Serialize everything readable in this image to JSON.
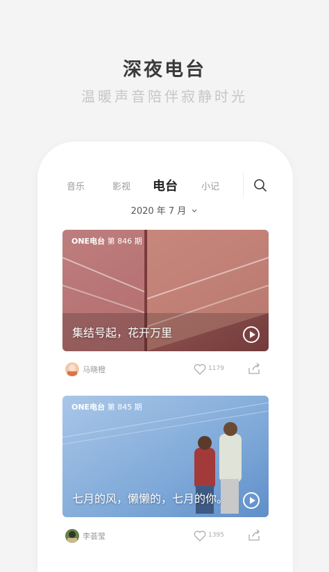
{
  "promo": {
    "title": "深夜电台",
    "subtitle": "温暖声音陪伴寂静时光"
  },
  "tabs": [
    {
      "label": "音乐",
      "active": false
    },
    {
      "label": "影视",
      "active": false
    },
    {
      "label": "电台",
      "active": true
    },
    {
      "label": "小记",
      "active": false
    }
  ],
  "search": {
    "icon": "search-icon"
  },
  "date_selector": {
    "label": "2020 年 7 月",
    "icon": "chevron-down-icon"
  },
  "cards": [
    {
      "brand": "ONE电台",
      "issue": "第 846 期",
      "caption": "集结号起，花开万里",
      "author": "马晓橙",
      "likes": "1179"
    },
    {
      "brand": "ONE电台",
      "issue": "第 845 期",
      "caption": "七月的风，懒懒的，七月的你。",
      "author": "李荟莹",
      "likes": "1395"
    }
  ]
}
